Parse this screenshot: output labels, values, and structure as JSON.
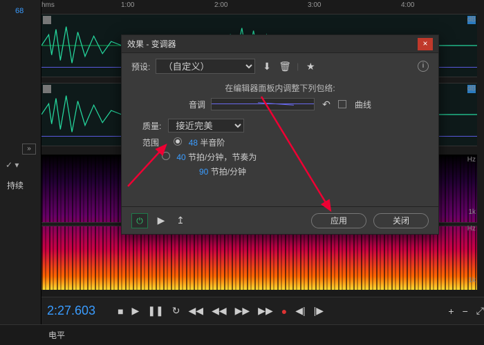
{
  "timeline": {
    "hms": "hms",
    "t1": "1:00",
    "t2": "2:00",
    "t3": "3:00",
    "t4": "4:00"
  },
  "leftcol": {
    "bluenum": "68",
    "split_glyph": "»",
    "check": "✓  ▾",
    "label": "持续"
  },
  "db": {
    "label": "dB"
  },
  "hz": {
    "label": "Hz",
    "k1": "1k"
  },
  "transport": {
    "timecode": "2:27.603",
    "stop": "■",
    "play": "▶",
    "pause": "❚❚",
    "loop": "↻",
    "prev": "◀◀",
    "rew": "◀◀",
    "ff": "▶▶",
    "next": "▶▶",
    "rec": "●",
    "skipb": "◀|",
    "skipf": "|▶",
    "zoomin": "+",
    "zoomout": "−",
    "zoomfit": "⤢"
  },
  "bottombar": {
    "label": "电平"
  },
  "dialog": {
    "title": "效果 - 变调器",
    "close": "×",
    "preset_label": "预设:",
    "preset_value": "（自定义）",
    "save_icon": "⬇",
    "trash_icon": "🗑",
    "star_icon": "★",
    "info_icon": "i",
    "section_label": "在编辑器面板内调整下列包络:",
    "pitch_label": "音调",
    "undo_icon": "↶",
    "curve_label": "曲线",
    "quality_label": "质量:",
    "quality_value": "接近完美",
    "range_label": "范围",
    "semitones_value": "48",
    "semitones_label": "半音阶",
    "bpm_value": "40",
    "bpm_label": "节拍/分钟，节奏为",
    "bpm2_value": "90",
    "bpm2_label": "节拍/分钟",
    "power_icon": "⏻",
    "play_icon": "▶",
    "export_icon": "↥",
    "apply": "应用",
    "close_btn": "关闭"
  }
}
